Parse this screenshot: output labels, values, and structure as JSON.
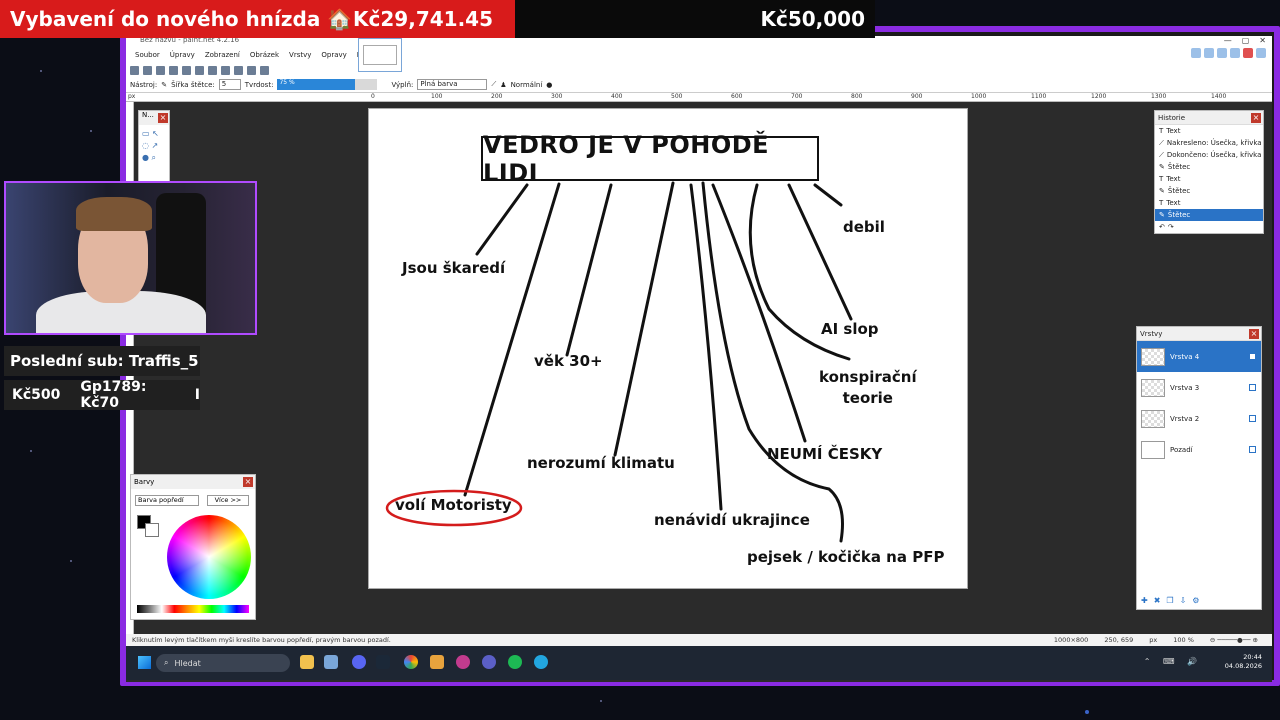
{
  "overlay": {
    "goal_title": "Vybavení do nového hnízda 🏠",
    "goal_current": "Kč29,741.45",
    "goal_target": "Kč50,000",
    "last_sub": "Poslední sub: Traffis_5",
    "donations": [
      "Kč500",
      "Gp1789: Kč70",
      "I"
    ]
  },
  "app": {
    "title": "Bez názvu - paint.net 4.2.16",
    "menu": [
      "Soubor",
      "Úpravy",
      "Zobrazení",
      "Obrázek",
      "Vrstvy",
      "Opravy",
      "Efekty"
    ],
    "toolbar": {
      "tool_label": "Nástroj:",
      "brush_width_label": "Šířka štětce:",
      "brush_width": "5",
      "hardness_label": "Tvrdost:",
      "hardness": "75 %",
      "fill_label": "Výplň:",
      "fill_value": "Plná barva",
      "blend": "Normální"
    },
    "ruler": [
      "px",
      "0",
      "100",
      "200",
      "300",
      "400",
      "500",
      "600",
      "700",
      "800",
      "900",
      "1000",
      "1100",
      "1200",
      "1300",
      "1400"
    ],
    "history": {
      "title": "Historie",
      "items": [
        "Text",
        "Nakresleno: Úsečka, křivka",
        "Dokončeno: Úsečka, křivka",
        "Štětec",
        "Text",
        "Štětec",
        "Text",
        "Štětec"
      ]
    },
    "layers": {
      "title": "Vrstvy",
      "items": [
        "Vrstva 4",
        "Vrstva 3",
        "Vrstva 2",
        "Pozadí"
      ]
    },
    "tools_title": "N...",
    "colors": {
      "title": "Barvy",
      "mode": "Barva popředí",
      "more": "Více >>"
    },
    "status": {
      "hint": "Kliknutím levým tlačítkem myši kreslíte barvou popředí, pravým barvou pozadí.",
      "size": "1000×800",
      "position": "250, 659",
      "unit": "px",
      "zoom": "100 %"
    }
  },
  "canvas": {
    "title": "VEDRO JE V POHODĚ LIDI",
    "labels": {
      "ugly": "Jsou škaredí",
      "age": "věk 30+",
      "climate": "nerozumí klimatu",
      "motoristy": "volí Motoristy",
      "ukraine": "nenávidí ukrajince",
      "pfp": "pejsek / kočička na PFP",
      "czech": "NEUMÍ ČESKY",
      "conspiracy": "konspirační\nteorie",
      "ai": "AI slop",
      "debil": "debil"
    }
  },
  "taskbar": {
    "search": "Hledat",
    "time": "20:44",
    "date": "04.08.2026"
  }
}
